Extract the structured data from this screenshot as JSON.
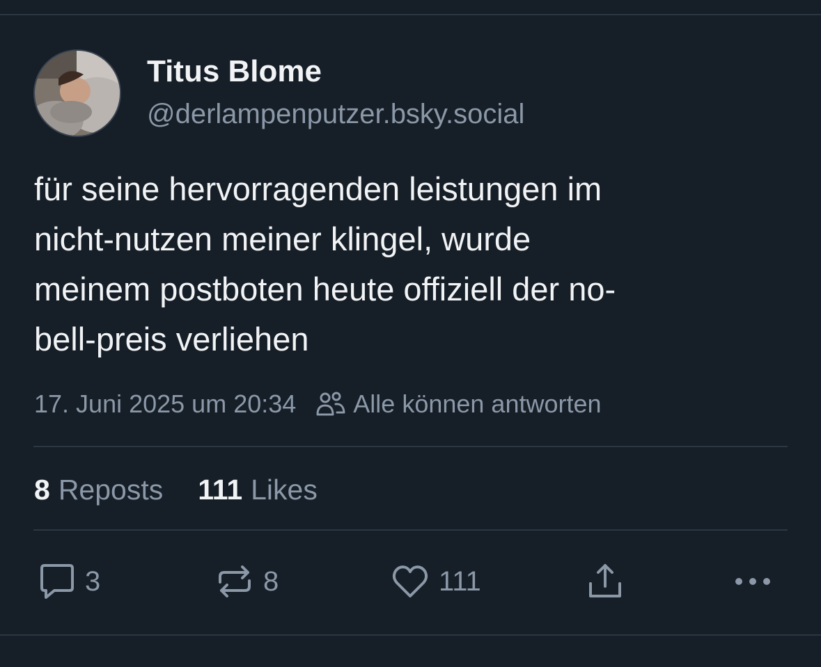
{
  "author": {
    "display_name": "Titus Blome",
    "handle": "@derlampenputzer.bsky.social"
  },
  "post": {
    "lines": [
      "für seine hervorragenden leistungen im",
      "nicht-nutzen meiner klingel, wurde",
      "meinem postboten heute offiziell der no-",
      "bell-preis verliehen"
    ],
    "timestamp": "17. Juni 2025 um 20:34",
    "reply_setting": "Alle können antworten",
    "reply_setting_icon": "people-icon"
  },
  "stats": {
    "reposts_count": "8",
    "reposts_label": "Reposts",
    "likes_count": "111",
    "likes_label": "Likes"
  },
  "actions": {
    "reply_count": "3",
    "repost_count": "8",
    "like_count": "111",
    "icons": [
      "reply-icon",
      "repost-icon",
      "heart-icon",
      "share-icon",
      "more-icon"
    ]
  },
  "colors": {
    "background": "#161e27",
    "text": "#f1f3f5",
    "muted": "#8b98a8",
    "divider": "#2c3744"
  }
}
